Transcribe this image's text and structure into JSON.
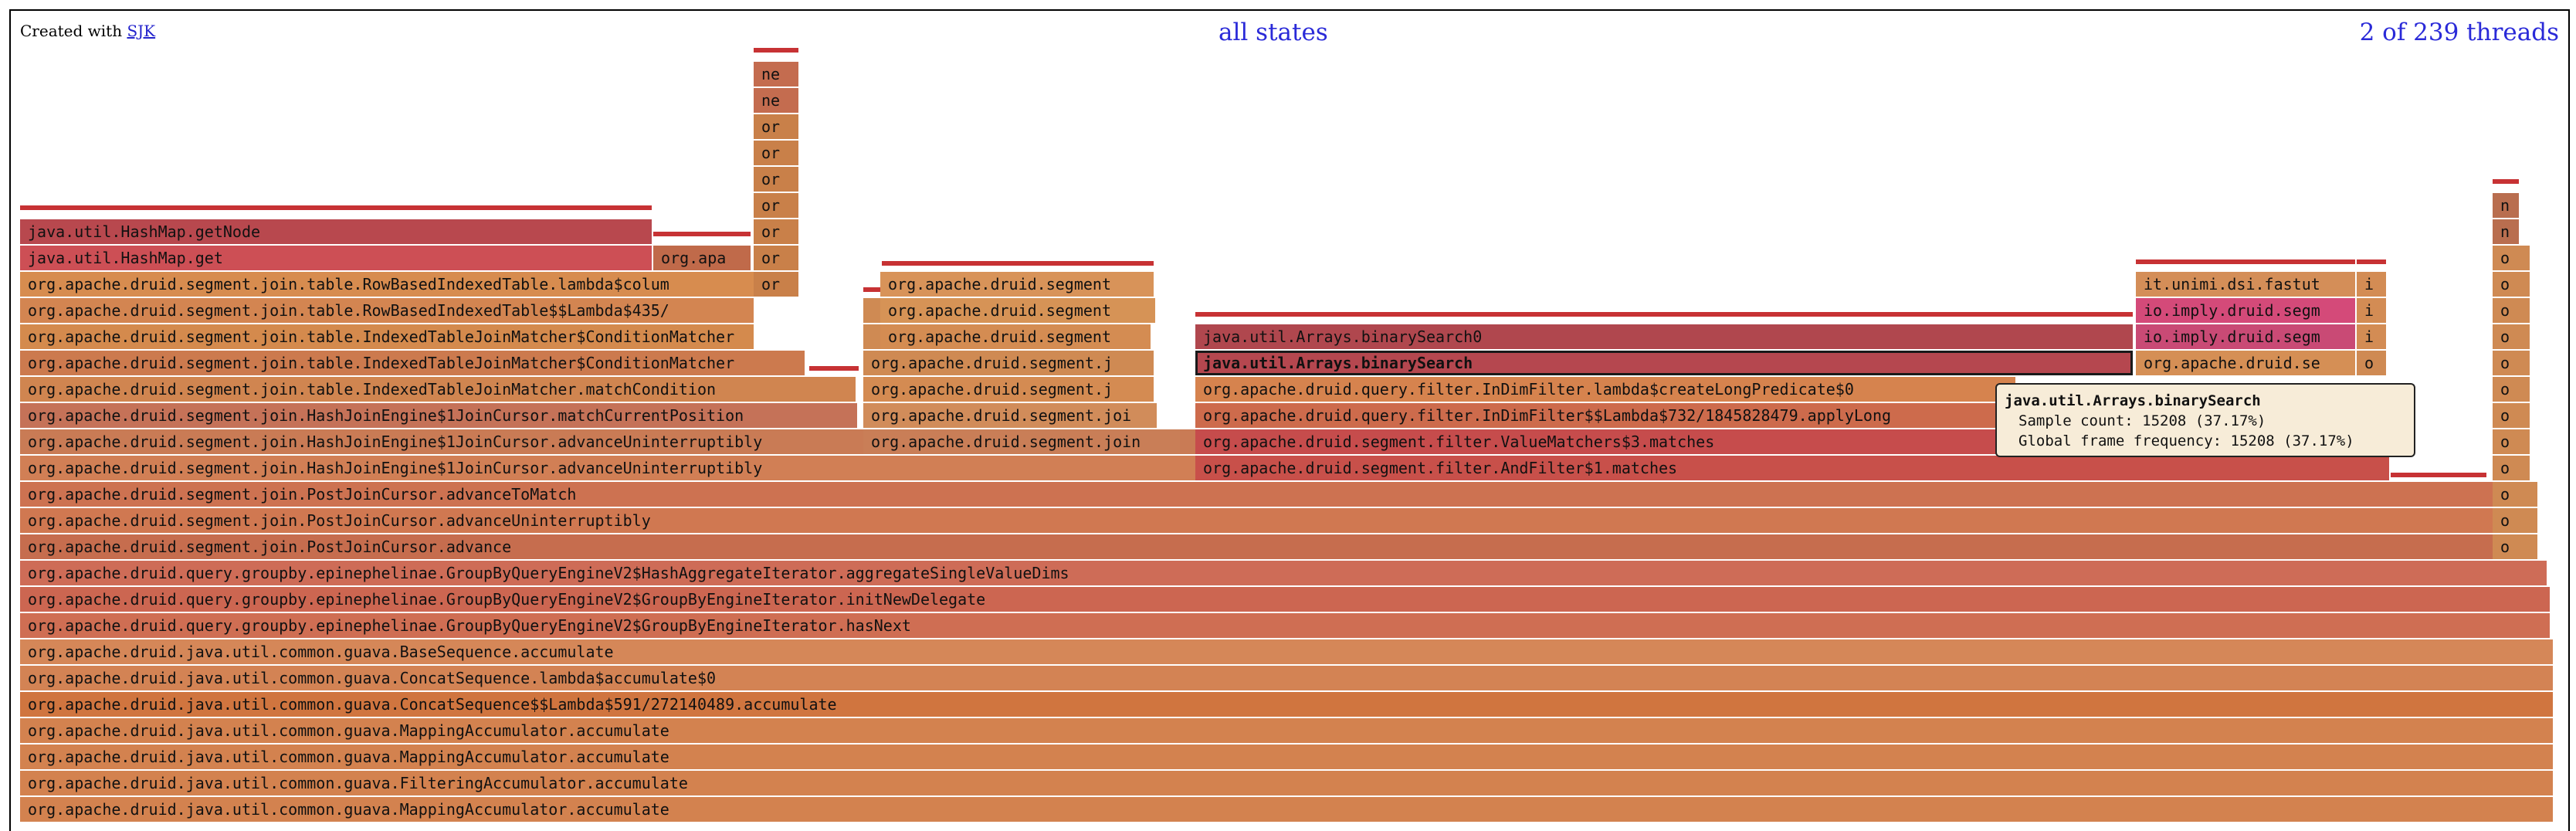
{
  "header": {
    "credit_prefix": "Created with",
    "credit_link": "SJK",
    "state_filter": "all states",
    "thread_count": "2 of 239 threads"
  },
  "tooltip": {
    "title": "java.util.Arrays.binarySearch",
    "sample_count": "Sample count: 15208 (37.17%)",
    "global_frequency": "Global frame frequency: 15208 (37.17%)"
  },
  "frames": [
    {
      "label": "org.apache.druid.java.util.common.guava.MappingAccumulator.accumulate",
      "color": "#d3824f"
    },
    {
      "label": "org.apache.druid.java.util.common.guava.FilteringAccumulator.accumulate",
      "color": "#d3824f"
    },
    {
      "label": "org.apache.druid.java.util.common.guava.MappingAccumulator.accumulate",
      "color": "#d3824f"
    },
    {
      "label": "org.apache.druid.java.util.common.guava.MappingAccumulator.accumulate",
      "color": "#d3824f"
    },
    {
      "label": "org.apache.druid.java.util.common.guava.ConcatSequence$$Lambda$591/272140489.accumulate",
      "color": "#d0753f"
    },
    {
      "label": "org.apache.druid.java.util.common.guava.ConcatSequence.lambda$accumulate$0",
      "color": "#d38354"
    },
    {
      "label": "org.apache.druid.java.util.common.guava.BaseSequence.accumulate",
      "color": "#d58758"
    },
    {
      "label": "org.apache.druid.query.groupby.epinephelinae.GroupByQueryEngineV2$GroupByEngineIterator.hasNext",
      "color": "#cf6e53"
    },
    {
      "label": "org.apache.druid.query.groupby.epinephelinae.GroupByQueryEngineV2$GroupByEngineIterator.initNewDelegate",
      "color": "#cc6651"
    },
    {
      "label": "org.apache.druid.query.groupby.epinephelinae.GroupByQueryEngineV2$HashAggregateIterator.aggregateSingleValueDims",
      "color": "#ce6c57"
    },
    {
      "label": "org.apache.druid.segment.join.PostJoinCursor.advance",
      "color": "#c66d4e"
    },
    {
      "label": "org.apache.druid.segment.join.PostJoinCursor.advanceUninterruptibly",
      "color": "#d07851"
    },
    {
      "label": "org.apache.druid.segment.join.PostJoinCursor.advanceToMatch",
      "color": "#cd7251"
    },
    {
      "label": "org.apache.druid.segment.join.HashJoinEngine$1JoinCursor.advanceUninterruptibly",
      "color": "#d17f55"
    },
    {
      "label": "org.apache.druid.segment.join.HashJoinEngine$1JoinCursor.advanceUninterruptibly",
      "color": "#c97b55"
    },
    {
      "label": "org.apache.druid.segment.join.HashJoinEngine$1JoinCursor.matchCurrentPosition",
      "color": "#c57258"
    },
    {
      "label": "org.apache.druid.segment.join.table.IndexedTableJoinMatcher.matchCondition",
      "color": "#d08550"
    },
    {
      "label": "org.apache.druid.segment.join.table.IndexedTableJoinMatcher$ConditionMatcher",
      "color": "#cc7a4e"
    },
    {
      "label": "org.apache.druid.segment.join.table.IndexedTableJoinMatcher$ConditionMatcher",
      "color": "#d48a4d"
    },
    {
      "label": "org.apache.druid.segment.join.table.RowBasedIndexedTable$$Lambda$435/",
      "color": "#d38551"
    },
    {
      "label": "org.apache.druid.segment.join.table.RowBasedIndexedTable.lambda$colum",
      "color": "#d78c4f"
    },
    {
      "label": "java.util.HashMap.get",
      "color": "#cd4f55"
    },
    {
      "label": "java.util.HashMap.getNode",
      "color": "#b8484e"
    },
    {
      "label": "org.apa",
      "color": "#c06a4a"
    },
    {
      "label": "or",
      "color": "#c98049"
    },
    {
      "label": "ne",
      "color": "#c46c4f"
    },
    {
      "label": "org.apache.druid.segment.join",
      "color": "#c97e57"
    },
    {
      "label": "org.apache.druid.segment.joi",
      "color": "#d18c5a"
    },
    {
      "label": "org.apache.druid.segment.j",
      "color": "#d48b52"
    },
    {
      "label": "org.apache.druid.segment.j",
      "color": "#cf8a53"
    },
    {
      "label": "org.apache.druid.segment",
      "color": "#d48c52"
    },
    {
      "label": "org.apache.druid.segment",
      "color": "#d69356"
    },
    {
      "label": "org.apache.druid.segment",
      "color": "#d89359"
    },
    {
      "label": "o",
      "color": "#cf8a53"
    },
    {
      "label": "org.apache.druid.segment.filter.AndFilter$1.matches",
      "color": "#c8504a"
    },
    {
      "label": "org.apache.druid.segment.filter.ValueMatchers$3.matches",
      "color": "#c64c4c"
    },
    {
      "label": "org.apache.druid.query.filter.InDimFilter$$Lambda$732/1845828479.applyLong",
      "color": "#cd6b4c"
    },
    {
      "label": "org.apache.druid.query.filter.InDimFilter.lambda$createLongPredicate$0",
      "color": "#d6834e"
    },
    {
      "label": "java.util.Arrays.binarySearch",
      "color": "#b5474f"
    },
    {
      "label": "java.util.Arrays.binarySearch0",
      "color": "#b0474e"
    },
    {
      "label": "org.apache.druid.se",
      "color": "#d58f55"
    },
    {
      "label": "io.imply.druid.segm",
      "color": "#c94a75"
    },
    {
      "label": "io.imply.druid.segm",
      "color": "#d44a79"
    },
    {
      "label": "it.unimi.dsi.fastut",
      "color": "#d48e58"
    },
    {
      "label": "i",
      "color": "#d38c54"
    },
    {
      "label": "n",
      "color": "#b96e4f"
    }
  ]
}
